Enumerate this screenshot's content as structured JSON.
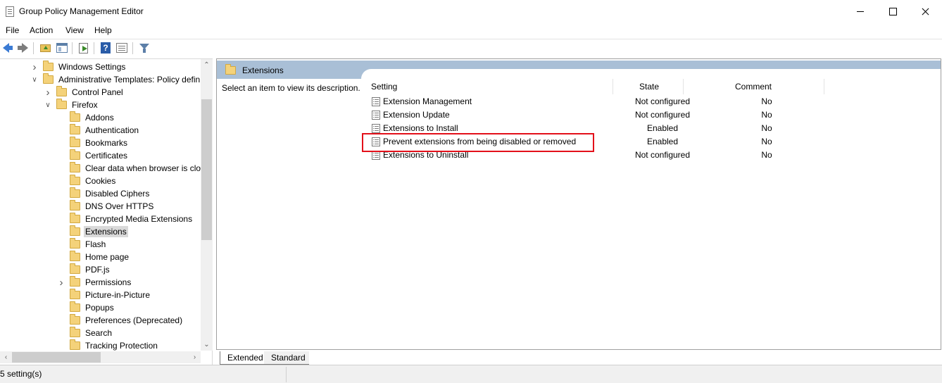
{
  "window": {
    "title": "Group Policy Management Editor"
  },
  "menu": {
    "items": [
      "File",
      "Action",
      "View",
      "Help"
    ]
  },
  "toolbar": {
    "icons": [
      "back-arrow-icon",
      "forward-arrow-icon",
      "folder-up-icon",
      "show-hide-tree-icon",
      "export-list-icon",
      "help-icon",
      "properties-icon",
      "filter-icon"
    ]
  },
  "tree": {
    "items": [
      {
        "label": "Windows Settings",
        "indent": 1,
        "expander": "collapsed"
      },
      {
        "label": "Administrative Templates: Policy defini",
        "indent": 1,
        "expander": "expanded"
      },
      {
        "label": "Control Panel",
        "indent": 2,
        "expander": "collapsed"
      },
      {
        "label": "Firefox",
        "indent": 2,
        "expander": "expanded"
      },
      {
        "label": "Addons",
        "indent": 3,
        "expander": "none"
      },
      {
        "label": "Authentication",
        "indent": 3,
        "expander": "none"
      },
      {
        "label": "Bookmarks",
        "indent": 3,
        "expander": "none"
      },
      {
        "label": "Certificates",
        "indent": 3,
        "expander": "none"
      },
      {
        "label": "Clear data when browser is clos",
        "indent": 3,
        "expander": "none"
      },
      {
        "label": "Cookies",
        "indent": 3,
        "expander": "none"
      },
      {
        "label": "Disabled Ciphers",
        "indent": 3,
        "expander": "none"
      },
      {
        "label": "DNS Over HTTPS",
        "indent": 3,
        "expander": "none"
      },
      {
        "label": "Encrypted Media Extensions",
        "indent": 3,
        "expander": "none"
      },
      {
        "label": "Extensions",
        "indent": 3,
        "expander": "none",
        "selected": true
      },
      {
        "label": "Flash",
        "indent": 3,
        "expander": "none"
      },
      {
        "label": "Home page",
        "indent": 3,
        "expander": "none"
      },
      {
        "label": "PDF.js",
        "indent": 3,
        "expander": "none"
      },
      {
        "label": "Permissions",
        "indent": 3,
        "expander": "collapsed"
      },
      {
        "label": "Picture-in-Picture",
        "indent": 3,
        "expander": "none"
      },
      {
        "label": "Popups",
        "indent": 3,
        "expander": "none"
      },
      {
        "label": "Preferences (Deprecated)",
        "indent": 3,
        "expander": "none"
      },
      {
        "label": "Search",
        "indent": 3,
        "expander": "none"
      },
      {
        "label": "Tracking Protection",
        "indent": 3,
        "expander": "none"
      }
    ]
  },
  "details": {
    "header": "Extensions",
    "description": "Select an item to view its description.",
    "columns": {
      "setting": "Setting",
      "state": "State",
      "comment": "Comment"
    },
    "rows": [
      {
        "setting": "Extension Management",
        "state": "Not configured",
        "comment": "No"
      },
      {
        "setting": "Extension Update",
        "state": "Not configured",
        "comment": "No"
      },
      {
        "setting": "Extensions to Install",
        "state": "Enabled",
        "comment": "No"
      },
      {
        "setting": "Prevent extensions from being disabled or removed",
        "state": "Enabled",
        "comment": "No",
        "highlighted": true
      },
      {
        "setting": "Extensions to Uninstall",
        "state": "Not configured",
        "comment": "No"
      }
    ],
    "highlight_color": "#e3101a"
  },
  "tabs": {
    "extended": "Extended",
    "standard": "Standard",
    "active": "Extended"
  },
  "status": {
    "text": "5 setting(s)"
  }
}
